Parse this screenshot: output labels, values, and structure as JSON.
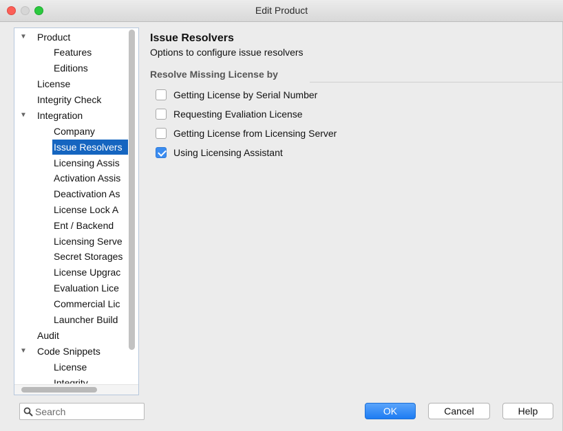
{
  "window": {
    "title": "Edit Product"
  },
  "tree": {
    "items": [
      {
        "label": "Product",
        "expanded": true
      },
      {
        "label": "Features"
      },
      {
        "label": "Editions"
      },
      {
        "label": "License"
      },
      {
        "label": "Integrity Check"
      },
      {
        "label": "Integration",
        "expanded": true
      },
      {
        "label": "Company"
      },
      {
        "label": "Issue Resolvers",
        "selected": true
      },
      {
        "label": "Licensing Assis"
      },
      {
        "label": "Activation Assis"
      },
      {
        "label": "Deactivation As"
      },
      {
        "label": "License Lock A"
      },
      {
        "label": "Ent / Backend"
      },
      {
        "label": "Licensing Serve"
      },
      {
        "label": "Secret Storages"
      },
      {
        "label": "License Upgrac"
      },
      {
        "label": "Evaluation Lice"
      },
      {
        "label": "Commercial Lic"
      },
      {
        "label": "Launcher Build"
      },
      {
        "label": "Audit"
      },
      {
        "label": "Code Snippets",
        "expanded": true
      },
      {
        "label": "License"
      },
      {
        "label": "Integrity"
      }
    ],
    "expander_glyph": "▼"
  },
  "search": {
    "placeholder": "Search",
    "value": ""
  },
  "panel": {
    "title": "Issue Resolvers",
    "subtitle": "Options to configure issue resolvers",
    "section_label": "Resolve Missing License by",
    "options": [
      {
        "label": "Getting License by Serial Number",
        "checked": false
      },
      {
        "label": "Requesting Evaliation License",
        "checked": false
      },
      {
        "label": "Getting License from Licensing Server",
        "checked": false
      },
      {
        "label": "Using Licensing Assistant",
        "checked": true
      }
    ]
  },
  "buttons": {
    "ok": "OK",
    "cancel": "Cancel",
    "help": "Help"
  },
  "colors": {
    "selection": "#1565c0",
    "accent": "#1d7cf2"
  }
}
